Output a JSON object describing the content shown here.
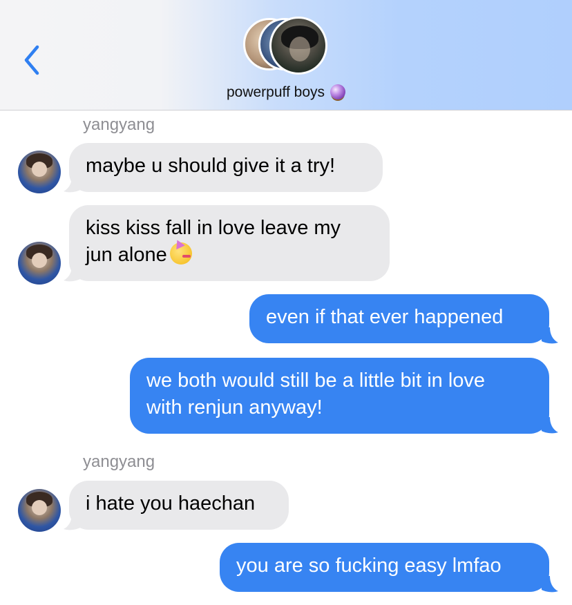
{
  "header": {
    "back_icon": "chevron-left-icon",
    "group_name": "powerpuff boys",
    "group_emoji": "crystal-ball-icon",
    "accent_color": "#3784f2"
  },
  "messages": [
    {
      "type": "sender",
      "text": "yangyang"
    },
    {
      "type": "in",
      "text": "maybe u should give it a try!"
    },
    {
      "type": "in",
      "lines": [
        "kiss kiss fall in love leave my",
        "jun alone"
      ],
      "emoji": "partying-face-icon"
    },
    {
      "type": "out",
      "text": "even if that ever happened"
    },
    {
      "type": "out",
      "lines": [
        "we both would still be a little bit in love",
        "with renjun anyway!"
      ]
    },
    {
      "type": "sender",
      "text": "yangyang"
    },
    {
      "type": "in",
      "text": "i hate you haechan"
    },
    {
      "type": "out",
      "text": "you are so fucking easy lmfao"
    }
  ]
}
